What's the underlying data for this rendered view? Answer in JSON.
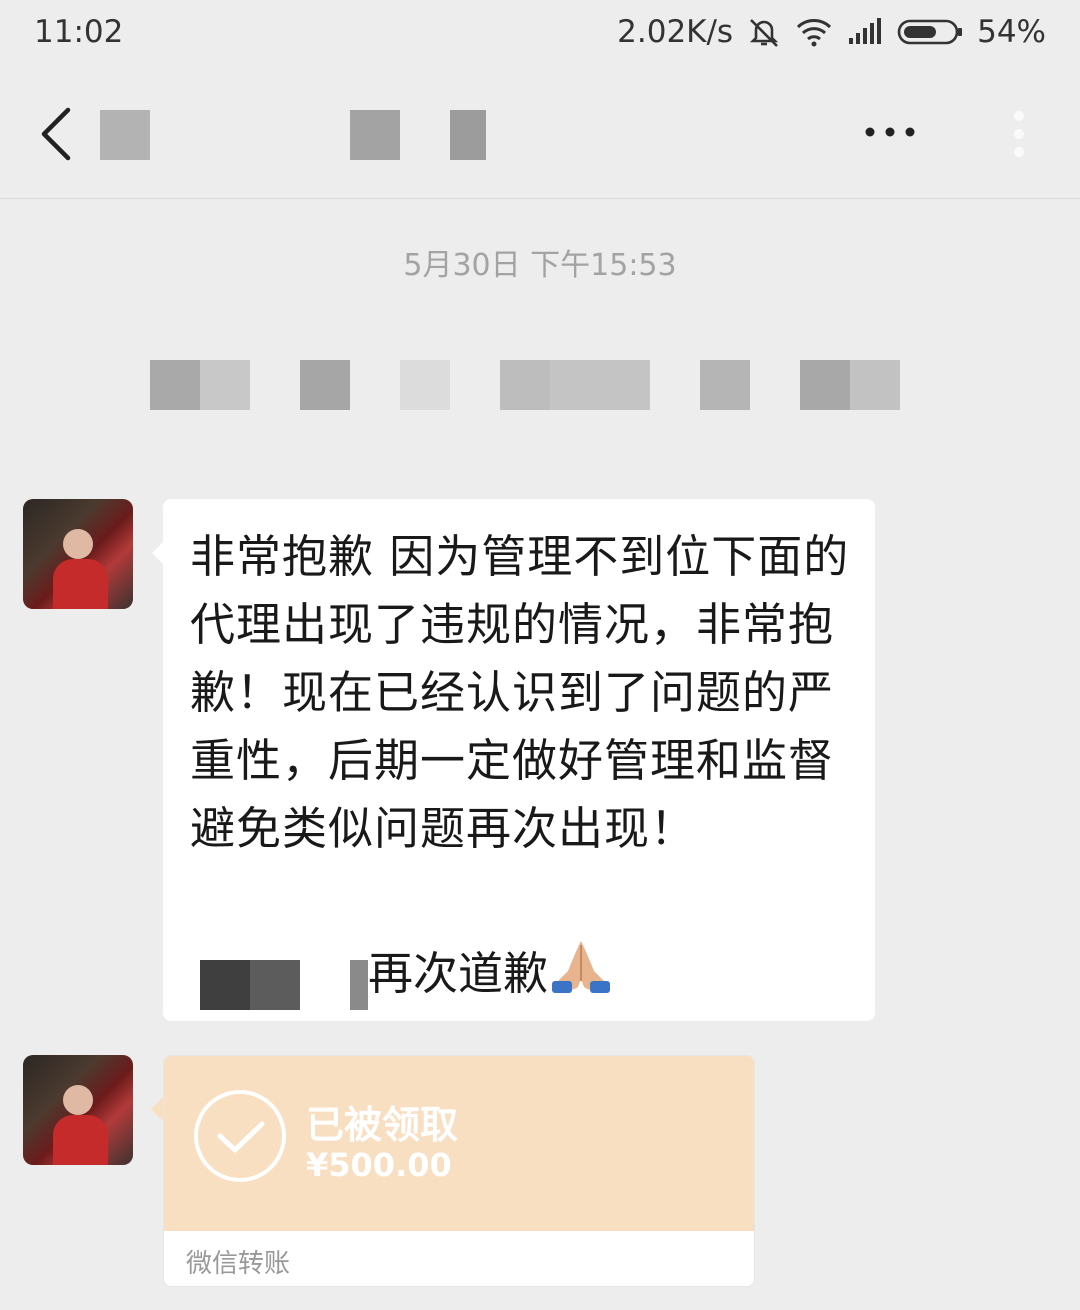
{
  "status_bar": {
    "time": "11:02",
    "net_speed": "2.02K/s",
    "battery": "54%"
  },
  "nav": {
    "back_icon": "chevron-left-icon",
    "more_icon": "more-dots-icon",
    "menu_icon": "kebab-vertical-icon"
  },
  "chat": {
    "timestamp": "5月30日 下午15:53",
    "message_text": "非常抱歉 因为管理不到位下面的代理出现了违规的情况，非常抱歉！现在已经认识到了问题的严重性，后期一定做好管理和监督避免类似问题再次出现！",
    "message_sorry": "再次道歉",
    "message_emoji": "folded-hands-icon"
  },
  "transfer": {
    "status": "已被领取",
    "amount": "¥500.00",
    "footer": "微信转账",
    "icon": "check-circle-icon"
  },
  "colors": {
    "background": "#ededed",
    "bubble": "#ffffff",
    "transfer_card": "#f9dfc2"
  }
}
